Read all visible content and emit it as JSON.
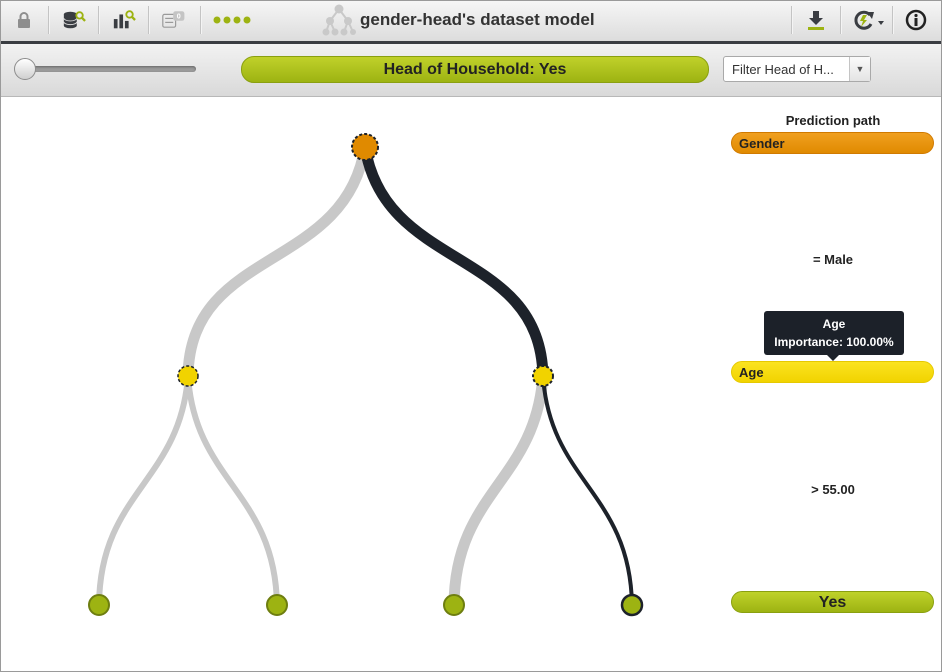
{
  "toolbar": {
    "title": "gender-head's dataset model",
    "icons": [
      "lock-icon",
      "dataset-search-icon",
      "model-search-icon",
      "filter-count-icon",
      "more-dots-icon",
      "tree-model-icon",
      "download-icon",
      "refresh-icon",
      "info-icon"
    ],
    "filter_count": "0",
    "accent_color": "#9db312"
  },
  "subbar": {
    "prediction": "Head of Household: Yes",
    "filter_label": "Filter Head of H...",
    "slider_value": 0
  },
  "panel": {
    "title": "Prediction path",
    "steps": [
      {
        "field": "Gender",
        "color": "#e08a00"
      },
      {
        "condition": "= Male"
      },
      {
        "field": "Age",
        "color": "#f1d300"
      },
      {
        "condition": "> 55.00"
      }
    ],
    "result": "Yes",
    "tooltip": {
      "title": "Age",
      "text": "Importance: 100.00%"
    }
  },
  "tree": {
    "root": {
      "field": "Gender",
      "color": "#e08a00"
    },
    "splits": [
      {
        "field": "Age",
        "color": "#f1d300"
      },
      {
        "field": "Age",
        "color": "#f1d300"
      }
    ],
    "leaves": [
      {
        "color": "#9db312"
      },
      {
        "color": "#9db312"
      },
      {
        "color": "#9db312"
      },
      {
        "color": "#9db312",
        "selected": true
      }
    ],
    "path_color": "#1d222a",
    "branch_color": "#c8c8c8"
  }
}
